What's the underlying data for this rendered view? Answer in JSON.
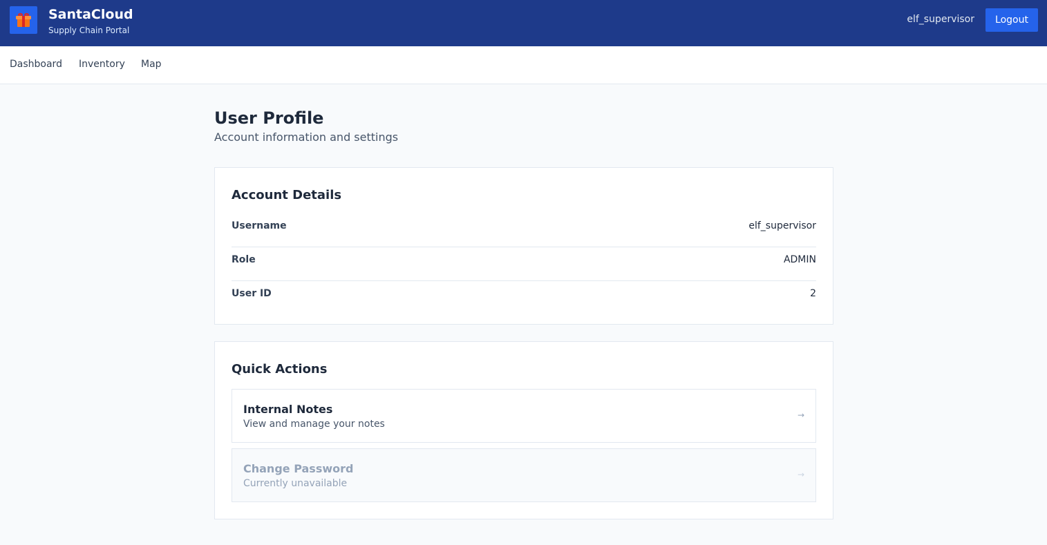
{
  "header": {
    "brand_title": "SantaCloud",
    "brand_subtitle": "Supply Chain Portal",
    "logo_icon": "gift-icon",
    "username": "elf_supervisor",
    "logout_label": "Logout"
  },
  "nav": {
    "items": [
      {
        "label": "Dashboard"
      },
      {
        "label": "Inventory"
      },
      {
        "label": "Map"
      }
    ]
  },
  "page": {
    "title": "User Profile",
    "subtitle": "Account information and settings"
  },
  "account_details": {
    "title": "Account Details",
    "rows": [
      {
        "label": "Username",
        "value": "elf_supervisor"
      },
      {
        "label": "Role",
        "value": "ADMIN"
      },
      {
        "label": "User ID",
        "value": "2"
      }
    ]
  },
  "quick_actions": {
    "title": "Quick Actions",
    "items": [
      {
        "title": "Internal Notes",
        "description": "View and manage your notes",
        "icon": "arrow-right-icon",
        "enabled": true
      },
      {
        "title": "Change Password",
        "description": "Currently unavailable",
        "icon": "arrow-right-icon",
        "enabled": false
      }
    ]
  },
  "colors": {
    "header_bg": "#1e3a8a",
    "accent": "#2563eb",
    "page_bg": "#f8fafc",
    "border": "#e2e8f0"
  }
}
